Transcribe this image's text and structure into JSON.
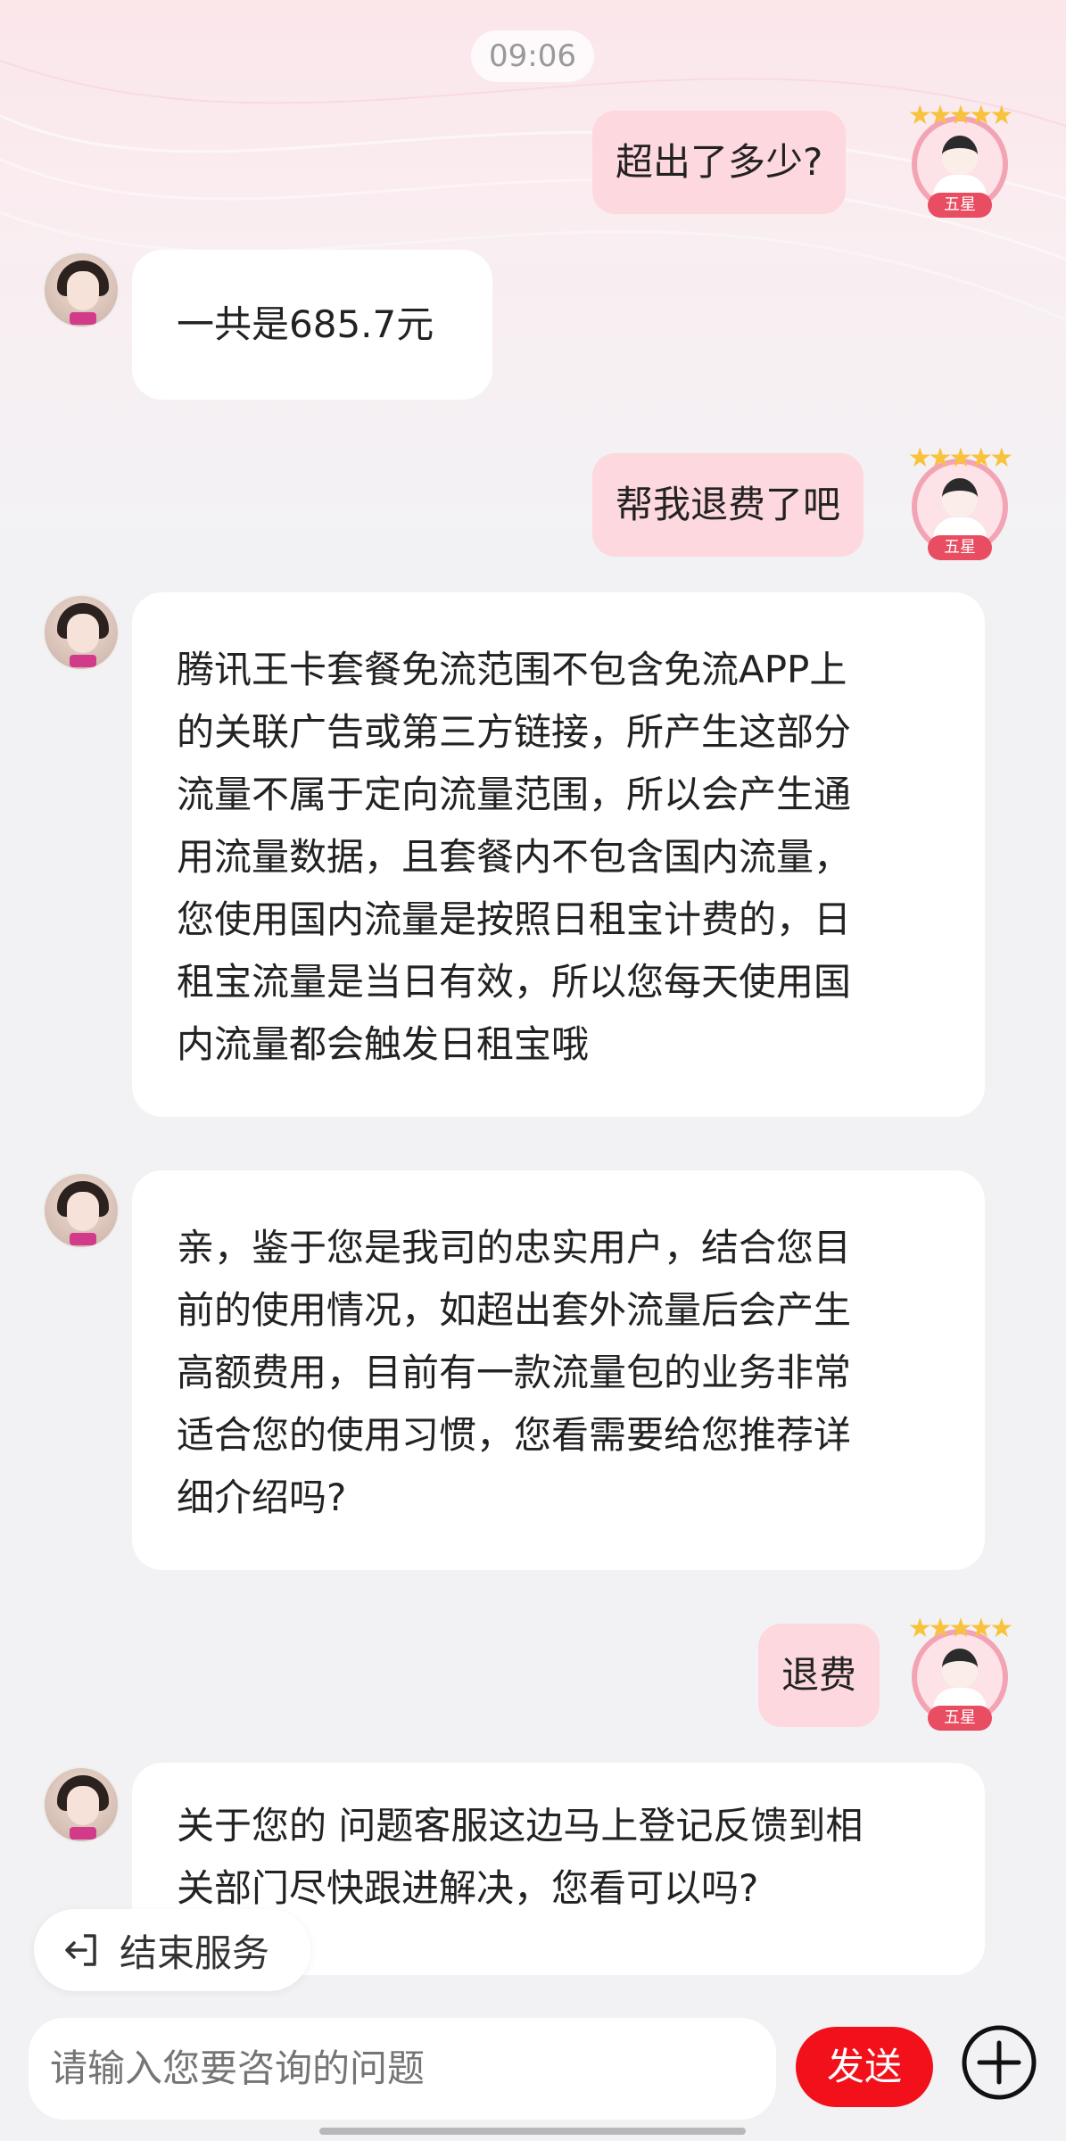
{
  "timestamp": "09:06",
  "user_badge": "五星",
  "messages": [
    {
      "role": "user",
      "text": "超出了多少?"
    },
    {
      "role": "agent",
      "text": "一共是685.7元"
    },
    {
      "role": "user",
      "text": "帮我退费了吧"
    },
    {
      "role": "agent",
      "lines": [
        "腾讯王卡套餐免流范围不包含免流APP上",
        "的关联广告或第三方链接，所产生这部分",
        "流量不属于定向流量范围，所以会产生通",
        "用流量数据，且套餐内不包含国内流量，",
        "您使用国内流量是按照日租宝计费的，日",
        "租宝流量是当日有效，所以您每天使用国",
        "内流量都会触发日租宝哦"
      ]
    },
    {
      "role": "agent",
      "lines": [
        "亲，鉴于您是我司的忠实用户，结合您目",
        "前的使用情况，如超出套外流量后会产生",
        "高额费用，目前有一款流量包的业务非常",
        "适合您的使用习惯，您看需要给您推荐详",
        "细介绍吗?"
      ]
    },
    {
      "role": "user",
      "text": "退费"
    },
    {
      "role": "agent",
      "lines": [
        "关于您的 问题客服这边马上登记反馈到相",
        "关部门尽快跟进解决，您看可以吗?"
      ]
    }
  ],
  "end_service": {
    "label": "结束服务",
    "icon": "exit-icon"
  },
  "input": {
    "placeholder": "请输入您要咨询的问题",
    "value": ""
  },
  "send_button": {
    "label": "发送"
  },
  "plus_button": {
    "icon": "plus-circle-icon"
  },
  "colors": {
    "user_bubble": "#fdd8de",
    "agent_bubble": "#ffffff",
    "send": "#f2101b",
    "page_bg": "#f2f2f5"
  }
}
